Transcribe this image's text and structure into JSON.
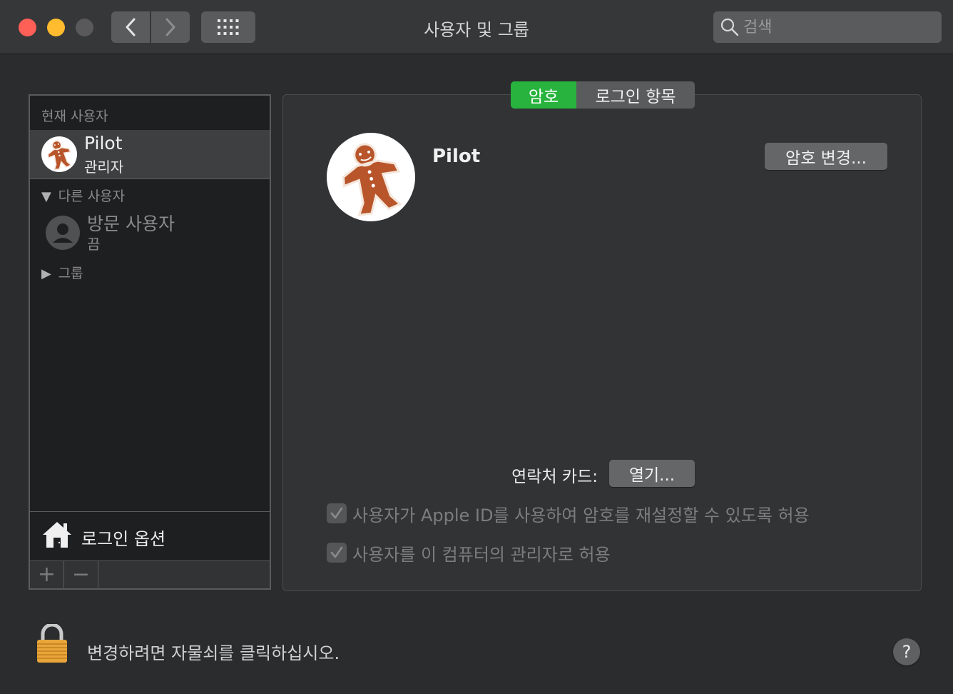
{
  "window": {
    "title": "사용자 및 그룹",
    "search_placeholder": "검색"
  },
  "sidebar": {
    "current_section_label": "현재 사용자",
    "current_user": {
      "name": "Pilot",
      "role": "관리자"
    },
    "other_section_label": "다른 사용자",
    "guest_user": {
      "name": "방문 사용자",
      "status": "끔"
    },
    "groups_label": "그룹",
    "login_options_label": "로그인 옵션",
    "add_symbol": "+",
    "remove_symbol": "−"
  },
  "tabs": [
    {
      "label": "암호",
      "active": true
    },
    {
      "label": "로그인 항목",
      "active": false
    }
  ],
  "main": {
    "user_name": "Pilot",
    "change_password_label": "암호 변경...",
    "contact_card_label": "연락처 카드:",
    "open_label": "열기...",
    "checkboxes": [
      {
        "label": "사용자가 Apple ID를 사용하여 암호를 재설정할 수 있도록 허용",
        "checked": true,
        "enabled": false
      },
      {
        "label": "사용자를 이 컴퓨터의 관리자로 허용",
        "checked": true,
        "enabled": false
      }
    ]
  },
  "footer": {
    "lock_message": "변경하려면 자물쇠를 클릭하십시오.",
    "help_label": "?"
  },
  "colors": {
    "accent_green": "#27b33d",
    "close": "#fe5f57",
    "minimize": "#febc2e",
    "zoom_disabled": "#59595b"
  },
  "icons": [
    "back-chevron-icon",
    "forward-chevron-icon",
    "grid-icon",
    "search-icon",
    "gingerbread-avatar-icon",
    "person-icon",
    "house-icon",
    "lock-icon",
    "checkmark-icon"
  ]
}
